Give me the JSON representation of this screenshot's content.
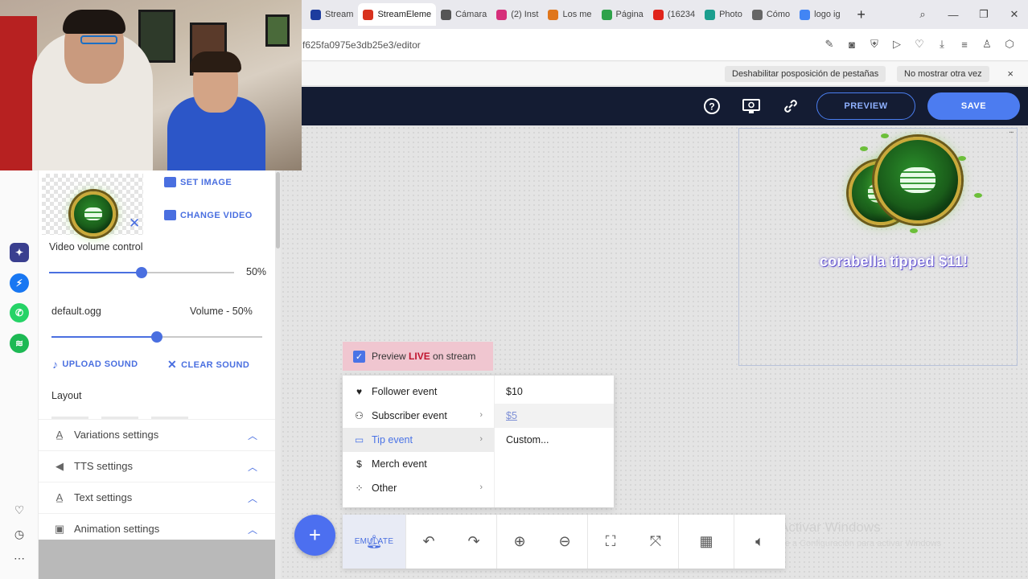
{
  "browser": {
    "tabs": [
      {
        "label": "Stream",
        "color": "#1d3c9e"
      },
      {
        "label": "StreamEleme",
        "color": "#d8321e",
        "active": true
      },
      {
        "label": "Cámara",
        "color": "#555555"
      },
      {
        "label": "(2) Inst",
        "color": "#d62e7a"
      },
      {
        "label": "Los me",
        "color": "#e0761b"
      },
      {
        "label": "Página",
        "color": "#2fa24a"
      },
      {
        "label": "(16234",
        "color": "#e0241b"
      },
      {
        "label": "Photo",
        "color": "#1b9e8e"
      },
      {
        "label": "Cómo",
        "color": "#666666"
      },
      {
        "label": "logo ig",
        "color": "#4285f4"
      }
    ],
    "new_tab": "+",
    "url": "f625fa0975e3db25e3/editor",
    "infobar": {
      "disable_btn": "Deshabilitar posposición de pestañas",
      "dont_show_btn": "No mostrar otra vez",
      "close": "×"
    }
  },
  "editor": {
    "preview_label": "PREVIEW",
    "save_label": "SAVE",
    "canvas": {
      "alert_name": "corabella",
      "alert_action": "tipped",
      "alert_amount": "$11!",
      "watermark_title": "Activar Windows",
      "watermark_sub": "Ve a Configuración para activar Windows"
    },
    "preview_live": {
      "prefix": "Preview",
      "live": "LIVE",
      "suffix": "on stream",
      "checked": true
    },
    "emulate_menu": {
      "events": [
        {
          "label": "Follower event",
          "icon": "heart-icon",
          "has_submenu": false
        },
        {
          "label": "Subscriber event",
          "icon": "user-plus-icon",
          "has_submenu": true
        },
        {
          "label": "Tip event",
          "icon": "credit-card-icon",
          "has_submenu": true,
          "selected": true
        },
        {
          "label": "Merch event",
          "icon": "dollar-icon",
          "has_submenu": false
        },
        {
          "label": "Other",
          "icon": "dots-icon",
          "has_submenu": true
        }
      ],
      "tip_options": [
        "$10",
        "$5",
        "Custom..."
      ]
    },
    "toolbar": {
      "add_label": "+",
      "emulate_label": "EMULATE"
    }
  },
  "panel": {
    "set_image": "SET IMAGE",
    "change_video": "CHANGE VIDEO",
    "video_volume_label": "Video volume control",
    "video_volume_value": "50%",
    "video_volume_fraction": 0.5,
    "sound_file": "default.ogg",
    "sound_volume_label": "Volume - 50%",
    "sound_volume_fraction": 0.5,
    "upload_sound": "UPLOAD SOUND",
    "clear_sound": "CLEAR SOUND",
    "layout_label": "Layout",
    "sections": [
      {
        "label": "Variations settings",
        "icon": "variations-icon"
      },
      {
        "label": "TTS settings",
        "icon": "speaker-icon"
      },
      {
        "label": "Text settings",
        "icon": "text-icon"
      },
      {
        "label": "Animation settings",
        "icon": "film-icon"
      }
    ]
  },
  "colors": {
    "accent": "#4c7cf0",
    "header_bg": "#141c33",
    "live_red": "#c0142e",
    "preview_live_bg": "#f0c6d0"
  }
}
